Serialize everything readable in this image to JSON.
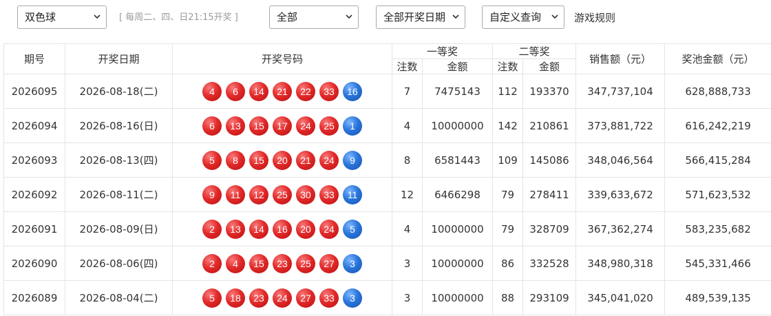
{
  "toolbar": {
    "lottery_select": "双色球",
    "hint": "[ 每周二、四、日21:15开奖 ]",
    "scope_select": "全部",
    "date_select": "全部开奖日期",
    "custom_select": "自定义查询",
    "rules_link": "游戏规则"
  },
  "table": {
    "headers": {
      "issue": "期号",
      "date": "开奖日期",
      "numbers": "开奖号码",
      "first_prize": "一等奖",
      "second_prize": "二等奖",
      "count": "注数",
      "amount": "金额",
      "sales": "销售额（元）",
      "pool": "奖池金额（元）"
    },
    "rows": [
      {
        "issue": "2026095",
        "date": "2026-08-18(二)",
        "reds": [
          "4",
          "6",
          "14",
          "21",
          "22",
          "33"
        ],
        "blue": "16",
        "first_count": "7",
        "first_amount": "7475143",
        "second_count": "112",
        "second_amount": "193370",
        "sales": "347,737,104",
        "pool": "628,888,733"
      },
      {
        "issue": "2026094",
        "date": "2026-08-16(日)",
        "reds": [
          "6",
          "13",
          "15",
          "17",
          "24",
          "25"
        ],
        "blue": "1",
        "first_count": "4",
        "first_amount": "10000000",
        "second_count": "142",
        "second_amount": "210861",
        "sales": "373,881,722",
        "pool": "616,242,219"
      },
      {
        "issue": "2026093",
        "date": "2026-08-13(四)",
        "reds": [
          "5",
          "8",
          "15",
          "20",
          "21",
          "24"
        ],
        "blue": "9",
        "first_count": "8",
        "first_amount": "6581443",
        "second_count": "109",
        "second_amount": "145086",
        "sales": "348,046,564",
        "pool": "566,415,284"
      },
      {
        "issue": "2026092",
        "date": "2026-08-11(二)",
        "reds": [
          "9",
          "11",
          "12",
          "25",
          "30",
          "33"
        ],
        "blue": "11",
        "first_count": "12",
        "first_amount": "6466298",
        "second_count": "79",
        "second_amount": "278411",
        "sales": "339,633,672",
        "pool": "571,623,532"
      },
      {
        "issue": "2026091",
        "date": "2026-08-09(日)",
        "reds": [
          "2",
          "13",
          "14",
          "16",
          "20",
          "24"
        ],
        "blue": "5",
        "first_count": "4",
        "first_amount": "10000000",
        "second_count": "79",
        "second_amount": "328709",
        "sales": "367,362,274",
        "pool": "583,235,682"
      },
      {
        "issue": "2026090",
        "date": "2026-08-06(四)",
        "reds": [
          "2",
          "4",
          "15",
          "23",
          "25",
          "27"
        ],
        "blue": "3",
        "first_count": "3",
        "first_amount": "10000000",
        "second_count": "86",
        "second_amount": "332528",
        "sales": "348,980,318",
        "pool": "545,331,466"
      },
      {
        "issue": "2026089",
        "date": "2026-08-04(二)",
        "reds": [
          "5",
          "18",
          "23",
          "24",
          "27",
          "33"
        ],
        "blue": "3",
        "first_count": "3",
        "first_amount": "10000000",
        "second_count": "88",
        "second_amount": "293109",
        "sales": "345,041,020",
        "pool": "489,539,135"
      }
    ]
  },
  "colors": {
    "red_ball": "#e32a2a",
    "blue_ball": "#2a76db",
    "border": "#e4e4e4",
    "hint_text": "#9a9a9a"
  }
}
